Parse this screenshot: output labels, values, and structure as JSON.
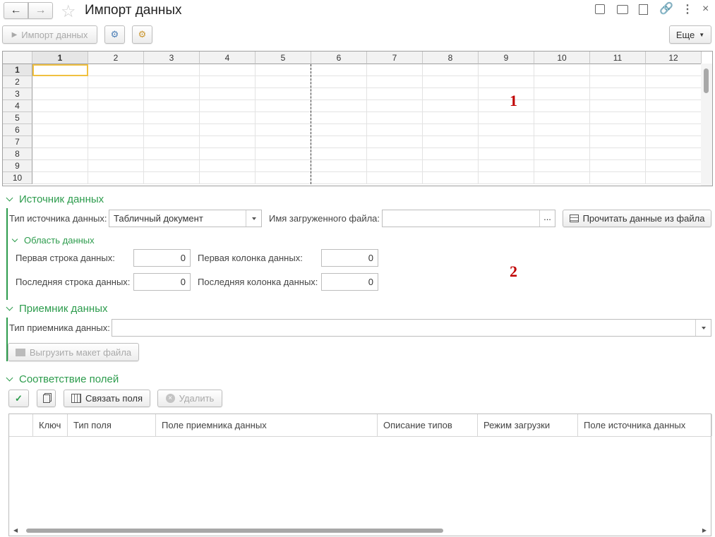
{
  "window": {
    "title": "Импорт данных"
  },
  "toolbar": {
    "import_label": "Импорт данных",
    "more_label": "Еще"
  },
  "sheet": {
    "columns": [
      "1",
      "2",
      "3",
      "4",
      "5",
      "6",
      "7",
      "8",
      "9",
      "10",
      "11",
      "12"
    ],
    "rows": [
      "1",
      "2",
      "3",
      "4",
      "5",
      "6",
      "7",
      "8",
      "9",
      "10"
    ],
    "annotation": "1"
  },
  "source": {
    "title": "Источник данных",
    "type_label": "Тип источника данных:",
    "type_value": "Табличный документ",
    "file_label": "Имя загруженного файла:",
    "file_value": "",
    "browse_label": "...",
    "read_button": "Прочитать данные из файла",
    "area": {
      "title": "Область данных",
      "first_row_label": "Первая строка данных:",
      "first_row": "0",
      "first_col_label": "Первая колонка данных:",
      "first_col": "0",
      "last_row_label": "Последняя строка данных:",
      "last_row": "0",
      "last_col_label": "Последняя колонка данных:",
      "last_col": "0"
    },
    "annotation": "2"
  },
  "receiver": {
    "title": "Приемник данных",
    "type_label": "Тип приемника данных:",
    "type_value": "",
    "export_button": "Выгрузить макет файла"
  },
  "mapping": {
    "title": "Соответствие полей",
    "link_button": "Связать поля",
    "delete_button": "Удалить",
    "columns": [
      "",
      "Ключ",
      "Тип поля",
      "Поле приемника данных",
      "Описание типов",
      "Режим загрузки",
      "Поле источника данных"
    ]
  },
  "colors": {
    "accent": "#2d9c4d",
    "annotation": "#c00000",
    "selection": "#f0c040"
  }
}
